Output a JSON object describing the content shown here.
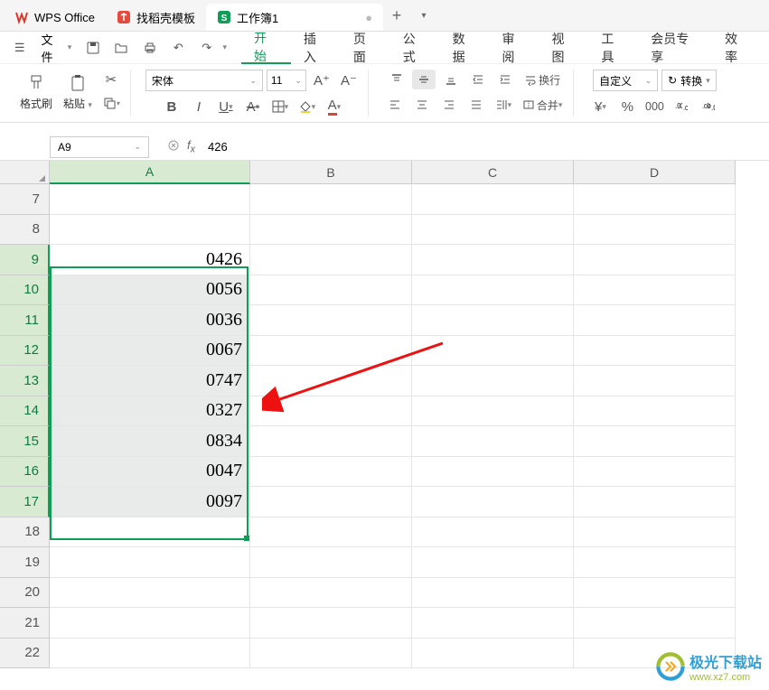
{
  "app": {
    "name": "WPS Office",
    "tabs": [
      {
        "label": "WPS Office",
        "icon": "wps",
        "active": false
      },
      {
        "label": "找稻壳模板",
        "icon": "docer",
        "active": false
      },
      {
        "label": "工作簿1",
        "icon": "sheet",
        "active": true
      }
    ]
  },
  "menu": {
    "file": "文件",
    "items": [
      "开始",
      "插入",
      "页面",
      "公式",
      "数据",
      "审阅",
      "视图",
      "工具",
      "会员专享",
      "效率"
    ],
    "active": "开始"
  },
  "toolbar": {
    "format_brush": "格式刷",
    "paste": "粘贴",
    "font": "宋体",
    "font_size": "11",
    "wrap": "换行",
    "merge": "合并",
    "num_format": "自定义",
    "convert": "转换"
  },
  "namebox": "A9",
  "formula": "426",
  "columns": [
    "A",
    "B",
    "C",
    "D"
  ],
  "rows": [
    "7",
    "8",
    "9",
    "10",
    "11",
    "12",
    "13",
    "14",
    "15",
    "16",
    "17",
    "18",
    "19",
    "20",
    "21",
    "22"
  ],
  "selected_rows": [
    "9",
    "10",
    "11",
    "12",
    "13",
    "14",
    "15",
    "16",
    "17"
  ],
  "cells": {
    "9": "0426",
    "10": "0056",
    "11": "0036",
    "12": "0067",
    "13": "0747",
    "14": "0327",
    "15": "0834",
    "16": "0047",
    "17": "0097"
  },
  "watermark": {
    "title": "极光下载站",
    "url": "www.xz7.com"
  }
}
